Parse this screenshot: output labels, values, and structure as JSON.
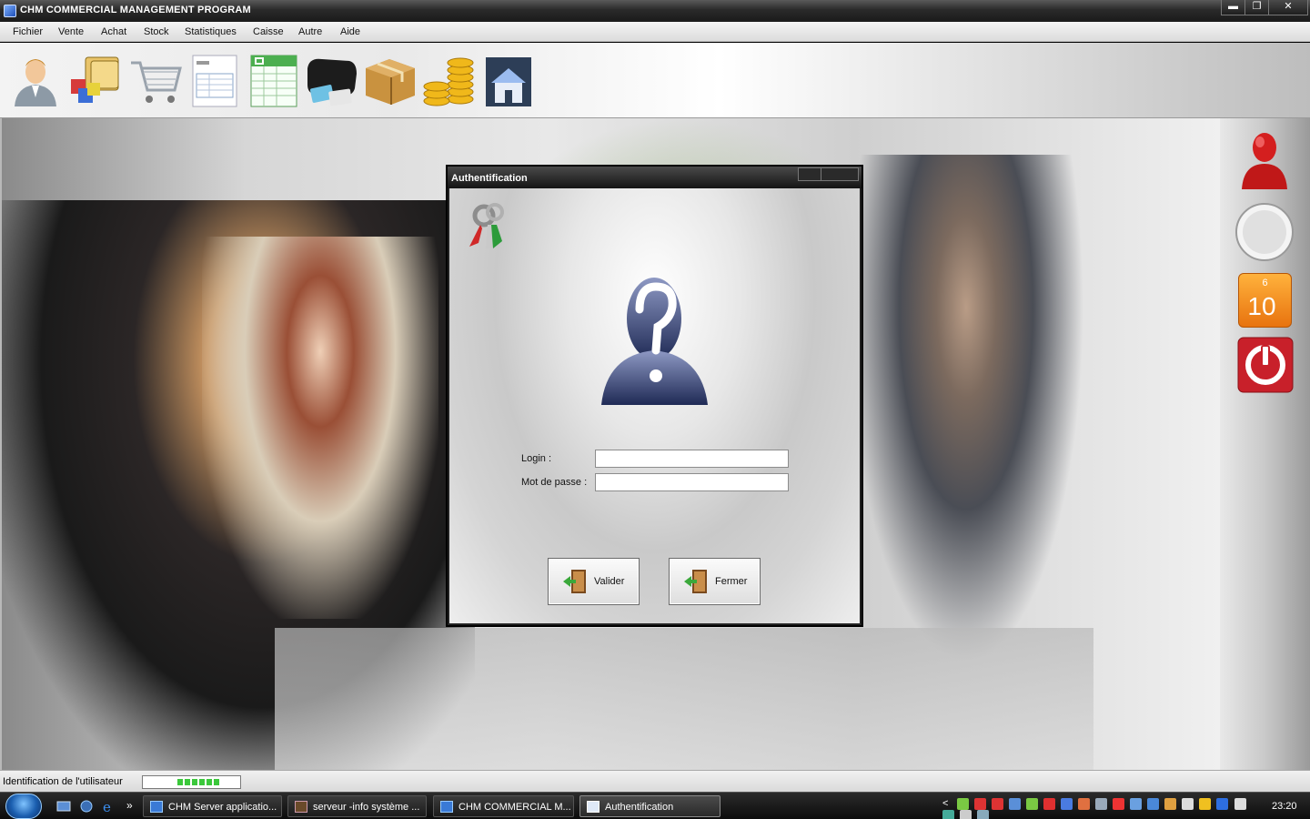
{
  "window": {
    "title": "CHM COMMERCIAL MANAGEMENT PROGRAM",
    "minimize": "▬",
    "restore": "❐",
    "close": "✕"
  },
  "menu": [
    "Fichier",
    "Vente",
    "Achat",
    "Stock",
    "Statistiques",
    "Caisse",
    "Autre",
    "Aide"
  ],
  "toolbar_icons": [
    "user-icon",
    "products-icon",
    "cart-icon",
    "invoice-icon",
    "spreadsheet-icon",
    "wallet-icon",
    "package-icon",
    "coins-icon",
    "house-icon"
  ],
  "sidebar": {
    "calendar_month": "6",
    "calendar_day": "10"
  },
  "dialog": {
    "title": "Authentification",
    "login_label": "Login :",
    "login_value": "",
    "password_label": "Mot de passe :",
    "password_value": "",
    "ok_label": "Valider",
    "close_label": "Fermer"
  },
  "status": {
    "text": "Identification de l'utilisateur",
    "progress_segments": 6
  },
  "taskbar": {
    "tasks": [
      {
        "label": "CHM Server applicatio...",
        "active": false
      },
      {
        "label": "serveur -info système ...",
        "active": false
      },
      {
        "label": "CHM COMMERCIAL M...",
        "active": false
      },
      {
        "label": "Authentification",
        "active": true
      }
    ],
    "chevron": "»",
    "tray_arrow": "<",
    "clock": "23:20"
  },
  "colors": {
    "progress": "#3bc83b",
    "power": "#c8202a",
    "calendar": "#f28a1a"
  }
}
